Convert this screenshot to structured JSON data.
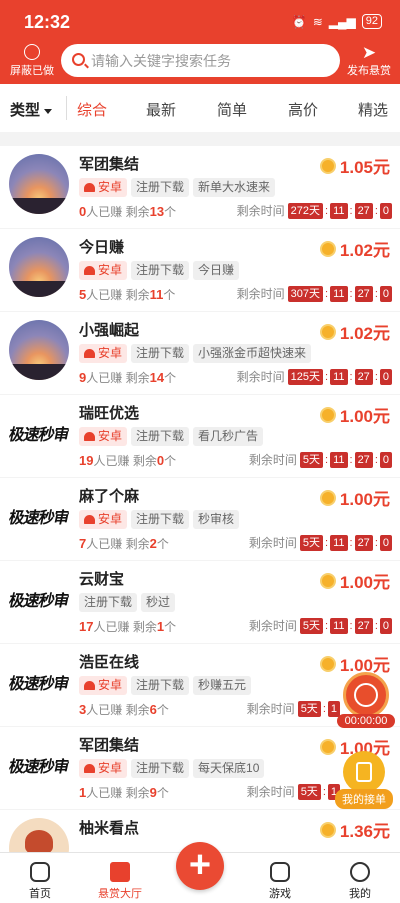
{
  "status_bar": {
    "time": "12:32",
    "battery": "92"
  },
  "header": {
    "shield_label": "屏蔽已做",
    "search_placeholder": "请输入关键字搜索任务",
    "publish_label": "发布悬赏"
  },
  "filter": {
    "type_label": "类型",
    "tabs": [
      "综合",
      "最新",
      "简单",
      "高价",
      "精选"
    ],
    "active_tab": "综合"
  },
  "labels": {
    "done_suffix": "人已赚",
    "remain_prefix": "剩余",
    "remain_suffix": "个",
    "time_label": "剩余时间"
  },
  "tasks": [
    {
      "title": "军团集结",
      "price": "1.05元",
      "tags": [
        "安卓",
        "注册下载",
        "新单大水速来"
      ],
      "done": "0",
      "left": "13",
      "days": "272天",
      "h": "11",
      "m": "27",
      "s": "0"
    },
    {
      "title": "今日赚",
      "price": "1.02元",
      "tags": [
        "安卓",
        "注册下载",
        "今日赚"
      ],
      "done": "5",
      "left": "11",
      "days": "307天",
      "h": "11",
      "m": "27",
      "s": "0"
    },
    {
      "title": "小强崛起",
      "price": "1.02元",
      "tags": [
        "安卓",
        "注册下载",
        "小强涨金币超快速来"
      ],
      "done": "9",
      "left": "14",
      "days": "125天",
      "h": "11",
      "m": "27",
      "s": "0"
    },
    {
      "title": "瑞旺优选",
      "price": "1.00元",
      "tags": [
        "安卓",
        "注册下载",
        "看几秒广告"
      ],
      "done": "19",
      "left": "0",
      "days": "5天",
      "h": "11",
      "m": "27",
      "s": "0"
    },
    {
      "title": "麻了个麻",
      "price": "1.00元",
      "tags": [
        "安卓",
        "注册下载",
        "秒审核"
      ],
      "done": "7",
      "left": "2",
      "days": "5天",
      "h": "11",
      "m": "27",
      "s": "0"
    },
    {
      "title": "云财宝",
      "price": "1.00元",
      "tags": [
        "注册下载",
        "秒过"
      ],
      "done": "17",
      "left": "1",
      "days": "5天",
      "h": "11",
      "m": "27",
      "s": "0"
    },
    {
      "title": "浩臣在线",
      "price": "1.00元",
      "tags": [
        "安卓",
        "注册下载",
        "秒赚五元"
      ],
      "done": "3",
      "left": "6",
      "days": "5天",
      "h": "1",
      "m": "",
      "s": ""
    },
    {
      "title": "军团集结",
      "price": "1.00元",
      "tags": [
        "安卓",
        "注册下载",
        "每天保底10"
      ],
      "done": "1",
      "left": "9",
      "days": "5天",
      "h": "1",
      "m": "",
      "s": ""
    },
    {
      "title": "柚米看点",
      "price": "1.36元",
      "tags": [],
      "done": "",
      "left": "",
      "days": "",
      "h": "",
      "m": "",
      "s": ""
    }
  ],
  "avatar_text": "极速秒审",
  "float": {
    "timer": "00:00:00",
    "my_orders": "我的接单"
  },
  "bottom_nav": [
    "首页",
    "悬赏大厅",
    "游戏",
    "我的"
  ],
  "plus_symbol": "+"
}
